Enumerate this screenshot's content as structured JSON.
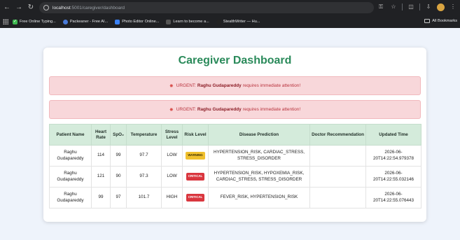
{
  "browser": {
    "url_host": "localhost",
    "url_rest": ":5001/caregiver/dashboard",
    "bookmarks": [
      {
        "label": "Free Online Typing...",
        "icon_color": "#3fb950",
        "icon": "check-icon"
      },
      {
        "label": "Packeaner - Free AI...",
        "icon_color": "#4a7bd8",
        "icon": "packeaner-icon"
      },
      {
        "label": "Photo Editor Online...",
        "icon_color": "#3b82f6",
        "icon": "photo-editor-icon"
      },
      {
        "label": "Learn to become a...",
        "icon_color": "#555555",
        "icon": "learn-icon"
      },
      {
        "label": "StealthWriter — Hu...",
        "icon_color": "#222222",
        "icon": "stealthwriter-icon"
      }
    ],
    "all_bookmarks": "All Bookmarks"
  },
  "dashboard": {
    "title": "Caregiver Dashboard",
    "accent_color": "#2a8a5a",
    "alerts": [
      {
        "prefix": "URGENT:",
        "name": "Raghu Gudapareddy",
        "suffix": "requires immediate attention!"
      },
      {
        "prefix": "URGENT:",
        "name": "Raghu Gudapareddy",
        "suffix": "requires immediate attention!"
      }
    ],
    "table": {
      "headers": {
        "patient_name": "Patient Name",
        "heart_rate": "Heart Rate",
        "spo2": "SpO₂",
        "temperature": "Temperature",
        "stress_level": "Stress Level",
        "risk_level": "Risk Level",
        "disease_prediction": "Disease Prediction",
        "doctor_recommendation": "Doctor Recommendation",
        "updated_time": "Updated Time"
      },
      "rows": [
        {
          "patient_name": "Raghu Gudapareddy",
          "heart_rate": "114",
          "spo2": "99",
          "temperature": "97.7",
          "stress_level": "LOW",
          "risk_level": "WARNING",
          "disease_prediction": "HYPERTENSION_RISK, CARDIAC_STRESS, STRESS_DISORDER",
          "doctor_recommendation": "",
          "updated_time": "2026-06-20T14:22:54.979378"
        },
        {
          "patient_name": "Raghu Gudapareddy",
          "heart_rate": "121",
          "spo2": "90",
          "temperature": "97.3",
          "stress_level": "LOW",
          "risk_level": "CRITICAL",
          "disease_prediction": "HYPERTENSION_RISK, HYPOXEMIA_RISK, CARDIAC_STRESS, STRESS_DISORDER",
          "doctor_recommendation": "",
          "updated_time": "2026-06-20T14:22:55.032146"
        },
        {
          "patient_name": "Raghu Gudapareddy",
          "heart_rate": "99",
          "spo2": "97",
          "temperature": "101.7",
          "stress_level": "HIGH",
          "risk_level": "CRITICAL",
          "disease_prediction": "FEVER_RISK, HYPERTENSION_RISK",
          "doctor_recommendation": "",
          "updated_time": "2026-06-20T14:22:55.076443"
        }
      ]
    }
  }
}
